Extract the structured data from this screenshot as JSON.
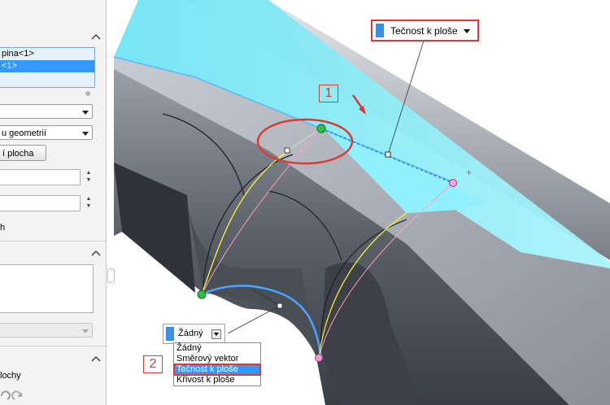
{
  "panel": {
    "list_items": [
      "pina<1>",
      "<1>"
    ],
    "combo_1": "",
    "combo_2": "u geometrií",
    "button_label": "í plocha",
    "text_h": "h",
    "bottom_label": "lochy"
  },
  "callouts": {
    "one": "1",
    "two": "2"
  },
  "tangent_label": {
    "text": "Tečnost k ploše"
  },
  "end_condition": {
    "selected": "Žádný",
    "options": [
      "Žádný",
      "Směrový vektor",
      "Tečnost k ploše",
      "Křivost k ploše"
    ]
  },
  "colors": {
    "accent": "#3a8ee6",
    "highlight_red": "#d93b35",
    "face_cyan": "#8ff0fb"
  },
  "icons": [
    "chevron-up-icon",
    "undo-icon",
    "redo-icon",
    "add-point-icon"
  ]
}
